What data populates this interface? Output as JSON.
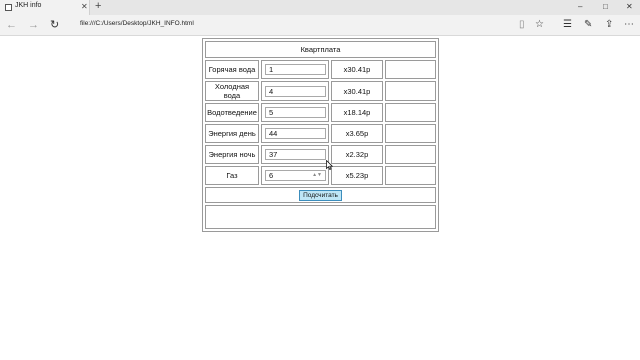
{
  "browser": {
    "tab_title": "JKH info",
    "tab_close": "✕",
    "new_tab": "+",
    "url": "file:///C:/Users/Desktop/JKH_INFO.html",
    "window_controls": {
      "minimize": "–",
      "maximize": "□",
      "close": "✕"
    }
  },
  "table": {
    "title": "Квартплата",
    "rows": [
      {
        "label": "Горячая вода",
        "value": "1",
        "rate": "x30.41р",
        "sum": ""
      },
      {
        "label": "Холодная вода",
        "value": "4",
        "rate": "x30.41р",
        "sum": ""
      },
      {
        "label": "Водотведение",
        "value": "5",
        "rate": "x18.14р",
        "sum": ""
      },
      {
        "label": "Энергия день",
        "value": "44",
        "rate": "x3.65р",
        "sum": ""
      },
      {
        "label": "Энергия ночь",
        "value": "37",
        "rate": "x2.32р",
        "sum": ""
      },
      {
        "label": "Газ",
        "value": "6",
        "rate": "x5.23р",
        "sum": ""
      }
    ],
    "calculate_label": "Подсчитать",
    "result": ""
  }
}
